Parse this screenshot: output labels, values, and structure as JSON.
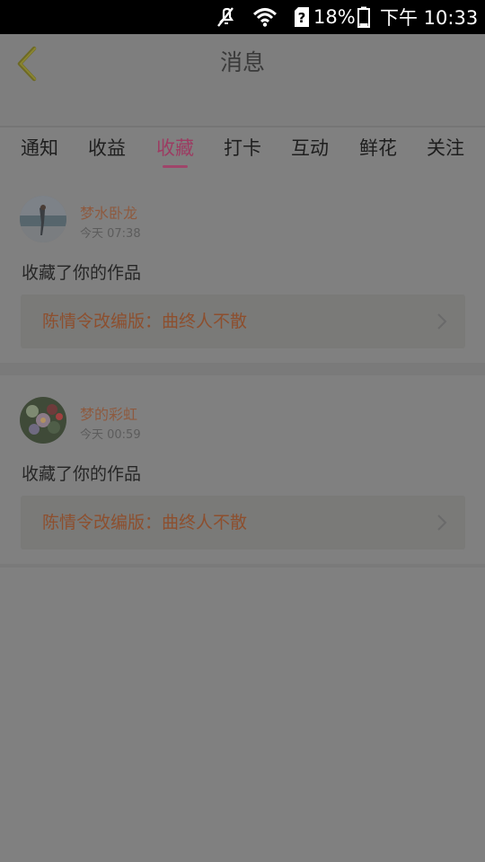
{
  "status_bar": {
    "battery_text": "18%",
    "time": "下午 10:33",
    "icons": [
      "mute-icon",
      "wifi-icon",
      "sim-unknown-icon",
      "battery-icon"
    ]
  },
  "header": {
    "title": "消息",
    "back_icon": "chevron-left-icon"
  },
  "tabs": [
    {
      "label": "通知",
      "active": false
    },
    {
      "label": "收益",
      "active": false
    },
    {
      "label": "收藏",
      "active": true
    },
    {
      "label": "打卡",
      "active": false
    },
    {
      "label": "互动",
      "active": false
    },
    {
      "label": "鲜花",
      "active": false
    },
    {
      "label": "关注",
      "active": false
    }
  ],
  "messages": [
    {
      "username": "梦水卧龙",
      "time": "今天 07:38",
      "action": "收藏了你的作品",
      "work_title": "陈情令改编版：曲终人不散",
      "avatar_icon": "avatar-photo"
    },
    {
      "username": "梦的彩虹",
      "time": "今天 00:59",
      "action": "收藏了你的作品",
      "work_title": "陈情令改编版：曲终人不散",
      "avatar_icon": "avatar-flowers"
    }
  ],
  "colors": {
    "overlay_bg": "#808080",
    "accent": "#a0456a",
    "username": "#8e5a3f",
    "work_title": "#8d4f2e"
  }
}
